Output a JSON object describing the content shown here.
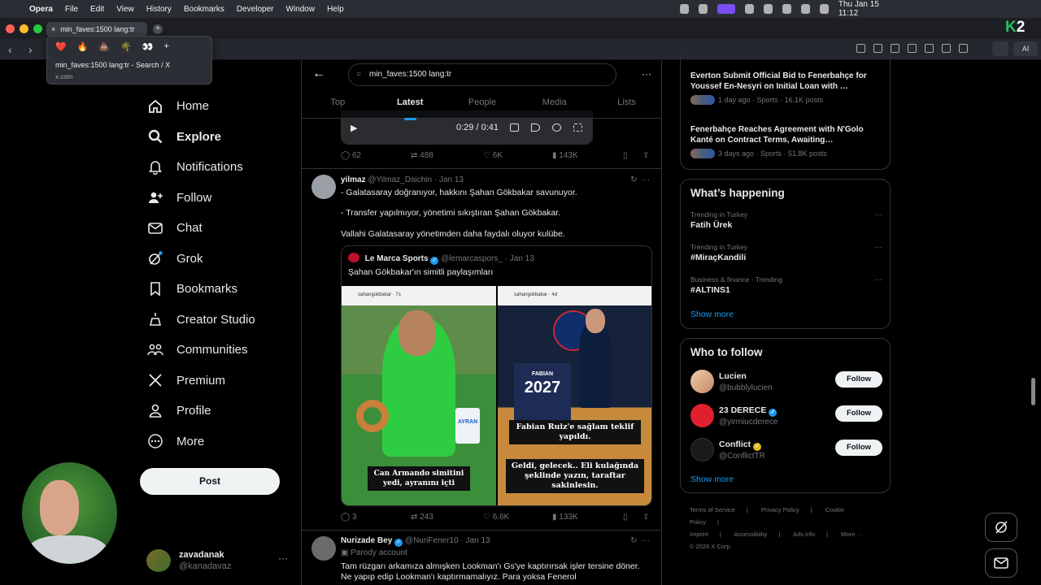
{
  "menubar": {
    "items": [
      "Opera",
      "File",
      "Edit",
      "View",
      "History",
      "Bookmarks",
      "Developer",
      "Window",
      "Help"
    ],
    "datetime": "Thu Jan 15  11:12"
  },
  "browser": {
    "tab_title": "min_faves:1500 lang:tr",
    "popup_title": "min_faves:1500 lang:tr - Search / X",
    "popup_url": "x.com",
    "popup_emojis": [
      "❤️",
      "🔥",
      "💩",
      "🌴",
      "👀",
      "+"
    ],
    "ext_ai_label": "AI",
    "k2_k": "K",
    "k2_2": "2"
  },
  "sidebar": {
    "items": [
      {
        "label": "Home",
        "icon": "home-icon"
      },
      {
        "label": "Explore",
        "icon": "search-icon"
      },
      {
        "label": "Notifications",
        "icon": "bell-icon"
      },
      {
        "label": "Follow",
        "icon": "add-user-icon"
      },
      {
        "label": "Chat",
        "icon": "mail-icon"
      },
      {
        "label": "Grok",
        "icon": "grok-icon"
      },
      {
        "label": "Bookmarks",
        "icon": "bookmark-icon"
      },
      {
        "label": "Creator Studio",
        "icon": "creator-icon"
      },
      {
        "label": "Communities",
        "icon": "communities-icon"
      },
      {
        "label": "Premium",
        "icon": "x-icon"
      },
      {
        "label": "Profile",
        "icon": "profile-icon"
      },
      {
        "label": "More",
        "icon": "more-icon"
      }
    ],
    "post_label": "Post",
    "account": {
      "name": "zavadanak",
      "handle": "@kanadavaz",
      "more": "···"
    }
  },
  "search": {
    "query": "min_faves:1500 lang:tr",
    "tabs": [
      "Top",
      "Latest",
      "People",
      "Media",
      "Lists"
    ],
    "active_tab": "Latest"
  },
  "video": {
    "time": "0:29 / 0:41"
  },
  "tweet0": {
    "actions": {
      "replies": "62",
      "reposts": "488",
      "likes": "6K",
      "views": "143K"
    }
  },
  "tweet1": {
    "name": "yilmaz",
    "handle": "@Yilmaz_Daichin · Jan 13",
    "lines": [
      "- Galatasaray doğranıyor, hakkını Şahan Gökbakar savunuyor.",
      "- Transfer yapılmıyor, yönetimi sıkıştıran Şahan Gökbakar.",
      "Vallahi Galatasaray yönetimden daha faydalı oluyor kulübe."
    ],
    "quote": {
      "name": "Le Marca Sports",
      "handle": "@lemarcaspors_ · Jan 13",
      "text": "Şahan Gökbakar'ın simitli paylaşımları",
      "left_user": "sahangokbakar",
      "left_age": "7s",
      "right_user": "sahangokbakar",
      "right_age": "4d",
      "left_caption": "Can Armando simitini yedi, ayranını içti",
      "right_caption_1": "Fabian Ruiz'e sağlam teklif yapıldı.",
      "right_caption_2": "Geldi, gelecek.. Eli kulağında şeklinde yazın, taraftar sakinlesin.",
      "cup_label": "AYRAN",
      "jersey_name": "FABIAN",
      "jersey_year": "2027"
    },
    "actions": {
      "replies": "3",
      "reposts": "243",
      "likes": "6.6K",
      "views": "133K"
    }
  },
  "tweet2": {
    "name": "Nurizade Bey",
    "handle": "@NuriFener10 · Jan 13",
    "label": "Parody account",
    "text": "Tam rüzgarı arkamıza almışken Lookman'ı Gs'ye kaptırırsak işler tersine döner. Ne yapıp edip Lookman'ı kaptırmamalıyız. Para yoksa Fenerol"
  },
  "right": {
    "news": [
      {
        "title": "Everton Submit Official Bid to Fenerbahçe for Youssef En-Nesyri on Initial Loan with …",
        "meta": "1 day ago · Sports · 16.1K posts"
      },
      {
        "title": "Fenerbahçe Reaches Agreement with N'Golo Kanté on Contract Terms, Awaiting…",
        "meta": "3 days ago · Sports · 51.8K posts"
      }
    ],
    "happening_title": "What’s happening",
    "trends": [
      {
        "context": "Trending in Turkey",
        "name": "Fatih Ürek"
      },
      {
        "context": "Trending in Turkey",
        "name": "#MiraçKandili"
      },
      {
        "context": "Business & finance · Trending",
        "name": "#ALTINS1"
      }
    ],
    "show_more": "Show more",
    "wtf_title": "Who to follow",
    "follow": [
      {
        "name": "Lucien",
        "handle": "@bubblylucien",
        "button": "Follow"
      },
      {
        "name": "23 DERECE",
        "handle": "@yirmiucderece",
        "button": "Follow"
      },
      {
        "name": "Conflict",
        "handle": "@ConflictTR",
        "button": "Follow"
      }
    ],
    "footer": [
      "Terms of Service",
      "|",
      "Privacy Policy",
      "|",
      "Cookie Policy",
      "|",
      "Imprint",
      "|",
      "Accessibility",
      "|",
      "Ads info",
      "|",
      "More ···",
      "© 2026 X Corp."
    ]
  }
}
